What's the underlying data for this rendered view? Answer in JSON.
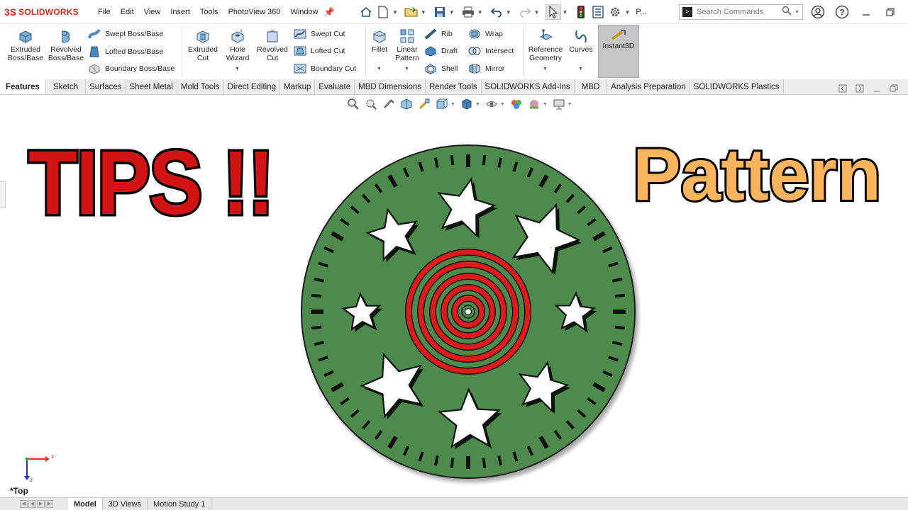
{
  "app": {
    "brand": "SOLIDWORKS",
    "brand_prefix": "3S"
  },
  "menu": [
    "File",
    "Edit",
    "View",
    "Insert",
    "Tools",
    "PhotoView 360",
    "Window"
  ],
  "quick_access": {
    "overflow_label": "P..."
  },
  "search": {
    "placeholder": "Search Commands"
  },
  "ribbon": {
    "extruded_boss": "Extruded\nBoss/Base",
    "revolved_boss": "Revolved\nBoss/Base",
    "swept_boss": "Swept Boss/Base",
    "lofted_boss": "Lofted Boss/Base",
    "boundary_boss": "Boundary Boss/Base",
    "extruded_cut": "Extruded\nCut",
    "hole_wizard": "Hole\nWizard",
    "revolved_cut": "Revolved\nCut",
    "swept_cut": "Swept Cut",
    "lofted_cut": "Lofted Cut",
    "boundary_cut": "Boundary Cut",
    "fillet": "Fillet",
    "linear_pattern": "Linear\nPattern",
    "rib": "Rib",
    "draft": "Draft",
    "shell": "Shell",
    "wrap": "Wrap",
    "intersect": "Intersect",
    "mirror": "Mirror",
    "reference_geometry": "Reference\nGeometry",
    "curves": "Curves",
    "instant3d": "Instant3D"
  },
  "tabs": [
    "Features",
    "Sketch",
    "Surfaces",
    "Sheet Metal",
    "Mold Tools",
    "Direct Editing",
    "Markup",
    "Evaluate",
    "MBD Dimensions",
    "Render Tools",
    "SOLIDWORKS Add-Ins",
    "MBD",
    "Analysis Preparation",
    "SOLIDWORKS Plastics"
  ],
  "active_tab": "Features",
  "overlay": {
    "left_title": "TIPS !!",
    "right_title": "Pattern"
  },
  "viewport": {
    "orientation_label": "*Top",
    "axis_x": "x",
    "axis_z": "z"
  },
  "bottom_tabs": [
    "Model",
    "3D Views",
    "Motion Study 1"
  ],
  "colors": {
    "part_green": "#4e8b4e",
    "ring_red": "#e01b1b",
    "tips_red": "#d21414",
    "pattern_orange": "#f7b45c",
    "brand_red": "#d52b1e"
  }
}
